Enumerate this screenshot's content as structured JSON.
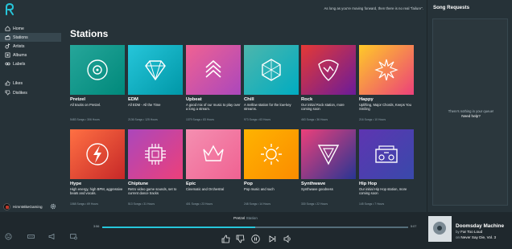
{
  "top": {
    "quote": "As long as you're moving forward, then there is no real \"failure\"."
  },
  "nav": {
    "items": [
      {
        "label": "Home",
        "icon": "home-icon"
      },
      {
        "label": "Stations",
        "icon": "stations-icon"
      },
      {
        "label": "Artists",
        "icon": "artists-icon"
      },
      {
        "label": "Albums",
        "icon": "albums-icon"
      },
      {
        "label": "Labels",
        "icon": "labels-icon"
      }
    ],
    "library": [
      {
        "label": "Likes",
        "icon": "thumbs-up-icon"
      },
      {
        "label": "Dislikes",
        "icon": "thumbs-down-icon"
      }
    ],
    "active": "Stations"
  },
  "user": {
    "name": "HimnMikeGaming"
  },
  "page": {
    "title": "Stations"
  },
  "stations": [
    {
      "name": "Pretzel",
      "desc": "All tracks on Pretzel.",
      "meta": "5483 Songs  •  306 Hours",
      "gradient": [
        "#26a69a",
        "#00897b"
      ],
      "icon": "vinyl-icon"
    },
    {
      "name": "EDM",
      "desc": "All EDM - All the Time",
      "meta": "2136 Songs  •  125 Hours",
      "gradient": [
        "#26c6da",
        "#0097a7"
      ],
      "icon": "diamond-icon"
    },
    {
      "name": "Upbeat",
      "desc": "A good mix of our music to play over a long a stream.",
      "meta": "1379 Songs  •  83 Hours",
      "gradient": [
        "#f06292",
        "#ab47bc"
      ],
      "icon": "chevrons-up-icon"
    },
    {
      "name": "Chill",
      "desc": "A mellow station for the low-key streams.",
      "meta": "973 Songs  •  63 Hours",
      "gradient": [
        "#4db6ac",
        "#00acc1"
      ],
      "icon": "hexagon-icon"
    },
    {
      "name": "Rock",
      "desc": "Our initial Rock station, more coming soon",
      "meta": "463 Songs  •  36 Hours",
      "gradient": [
        "#e53935",
        "#6a1b9a"
      ],
      "icon": "guitar-pick-icon"
    },
    {
      "name": "Happy",
      "desc": "Uplifting, Major Chords, Keeps You Smiling",
      "meta": "216 Songs  •  10 Hours",
      "gradient": [
        "#ffca28",
        "#ec407a"
      ],
      "icon": "sunburst-icon"
    },
    {
      "name": "Hype",
      "desc": "High energy, high BPM, aggressive beats and vocals.",
      "meta": "1068 Songs  •  69 Hours",
      "gradient": [
        "#ff7043",
        "#c62828"
      ],
      "icon": "lightning-icon"
    },
    {
      "name": "Chiptune",
      "desc": "Retro video game sounds, set to current dance tracks",
      "meta": "513 Songs  •  31 Hours",
      "gradient": [
        "#ab47bc",
        "#ec407a"
      ],
      "icon": "chip-icon"
    },
    {
      "name": "Epic",
      "desc": "Cinematic and Orchestral",
      "meta": "401 Songs  •  23 Hours",
      "gradient": [
        "#f48fb1",
        "#f06292"
      ],
      "icon": "crown-icon"
    },
    {
      "name": "Pop",
      "desc": "Pop music and such",
      "meta": "248 Songs  •  14 Hours",
      "gradient": [
        "#ffb300",
        "#fb8c00"
      ],
      "icon": "sun-icon"
    },
    {
      "name": "Synthwave",
      "desc": "Synthwave goodness",
      "meta": "330 Songs  •  22 Hours",
      "gradient": [
        "#ec407a",
        "#283593"
      ],
      "icon": "triangle-icon"
    },
    {
      "name": "Hip Hop",
      "desc": "Our initial Hip Hop station, more coming soon",
      "meta": "145 Songs  •  7 Hours",
      "gradient": [
        "#5e35b1",
        "#3949ab"
      ],
      "icon": "boombox-icon"
    }
  ],
  "requests": {
    "title": "Song Requests",
    "empty_text": "There's nothing in your queue!",
    "help_text": "Need help?"
  },
  "player": {
    "station_label": "Pretzel",
    "station_sub": "Station",
    "elapsed": "3:56",
    "duration": "5:07",
    "progress": 0.5,
    "song_title": "Doomsday Machine",
    "artist_prefix": "by",
    "artist": "Far Too Loud",
    "album_prefix": "on",
    "album": "Never Say Die, Vol. 3"
  }
}
